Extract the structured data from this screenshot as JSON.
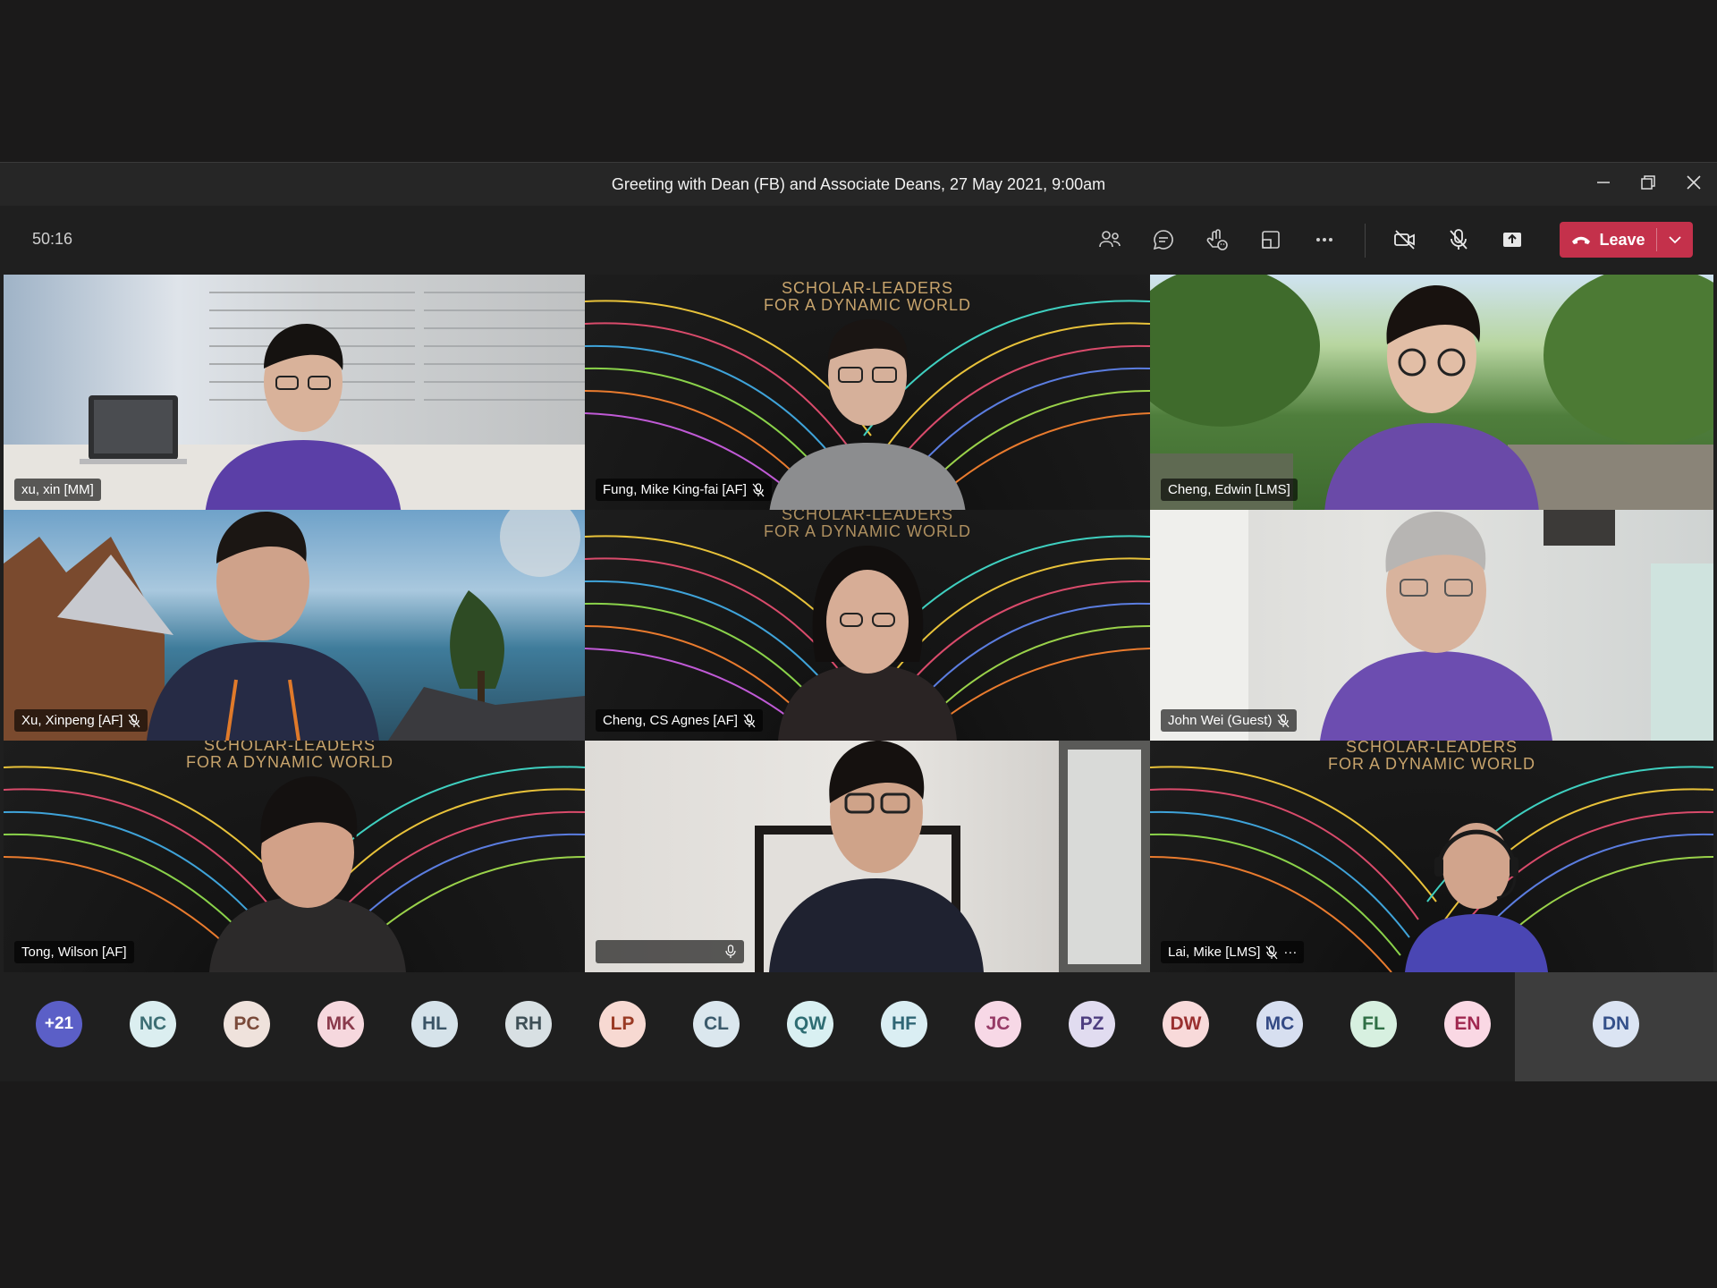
{
  "window": {
    "title": "Greeting with Dean (FB) and Associate Deans, 27 May 2021, 9:00am"
  },
  "toolbar": {
    "timer": "50:16",
    "leave_label": "Leave",
    "icons": [
      "people-icon",
      "chat-icon",
      "reactions-icon",
      "rooms-icon",
      "more-icon",
      "camera-off-icon",
      "mic-off-icon",
      "share-icon"
    ]
  },
  "participants": [
    {
      "name": "xu, xin [MM]",
      "muted": false
    },
    {
      "name": "Fung, Mike King-fai [AF]",
      "muted": true
    },
    {
      "name": "Cheng, Edwin [LMS]",
      "muted": false
    },
    {
      "name": "Xu, Xinpeng [AF]",
      "muted": true
    },
    {
      "name": "Cheng, CS Agnes [AF]",
      "muted": true
    },
    {
      "name": "John Wei (Guest)",
      "muted": true
    },
    {
      "name": "Tong, Wilson [AF]",
      "muted": false
    },
    {
      "name": "",
      "muted": false,
      "speaking": true
    },
    {
      "name": "Lai, Mike [LMS]",
      "muted": true,
      "more": "···"
    }
  ],
  "background_text": {
    "line1": "SCHOLAR-LEADERS",
    "line2": "FOR A DYNAMIC WORLD"
  },
  "roster": {
    "overflow": "+21",
    "avatars": [
      {
        "initials": "NC",
        "bg": "#dbeef0",
        "fg": "#3c6e74"
      },
      {
        "initials": "PC",
        "bg": "#efe2dc",
        "fg": "#7a4a3a"
      },
      {
        "initials": "MK",
        "bg": "#f6d8de",
        "fg": "#8a3a4c"
      },
      {
        "initials": "HL",
        "bg": "#d6e3ea",
        "fg": "#3a5466"
      },
      {
        "initials": "RH",
        "bg": "#d8e0e3",
        "fg": "#3e4f56"
      },
      {
        "initials": "LP",
        "bg": "#f7d9d2",
        "fg": "#9a3a24"
      },
      {
        "initials": "CL",
        "bg": "#dbe7ee",
        "fg": "#3b5a6c"
      },
      {
        "initials": "QW",
        "bg": "#d9f0f2",
        "fg": "#2e6d73"
      },
      {
        "initials": "HF",
        "bg": "#daeef3",
        "fg": "#2f6675"
      },
      {
        "initials": "JC",
        "bg": "#f7d8e6",
        "fg": "#963a66"
      },
      {
        "initials": "PZ",
        "bg": "#e1dcf0",
        "fg": "#4e3e80"
      },
      {
        "initials": "DW",
        "bg": "#f8dada",
        "fg": "#9a3030"
      },
      {
        "initials": "MC",
        "bg": "#d7dff0",
        "fg": "#334a85"
      },
      {
        "initials": "FL",
        "bg": "#d7f0e0",
        "fg": "#2f6f45"
      },
      {
        "initials": "EN",
        "bg": "#fad8e4",
        "fg": "#a02850"
      }
    ],
    "self": {
      "initials": "DN",
      "bg": "#dbe4f3",
      "fg": "#34508a"
    }
  }
}
